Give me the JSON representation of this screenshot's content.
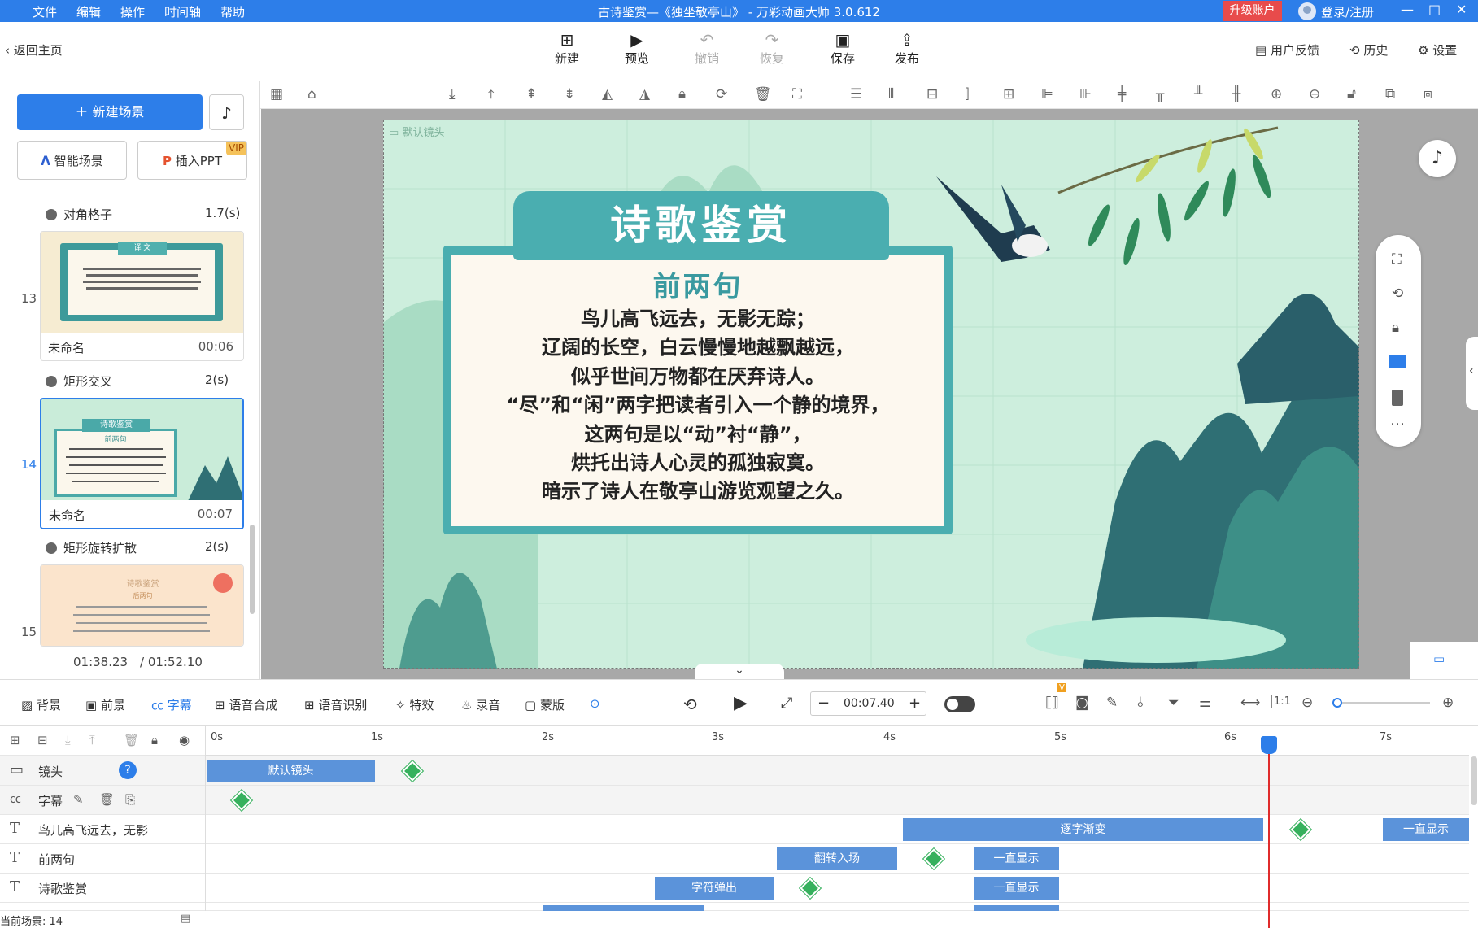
{
  "titlebar": {
    "menu": [
      "文件",
      "编辑",
      "操作",
      "时间轴",
      "帮助"
    ],
    "title": "古诗鉴赏—《独坐敬亭山》 - 万彩动画大师 3.0.612",
    "upgrade": "升级账户",
    "login": "登录/注册",
    "controls": [
      "—",
      "□",
      "✕"
    ]
  },
  "toolbar": {
    "back": "返回主页",
    "buttons": [
      {
        "label": "新建",
        "icon": "plus-square-icon"
      },
      {
        "label": "预览",
        "icon": "play-icon"
      },
      {
        "label": "撤销",
        "icon": "undo-icon",
        "disabled": true
      },
      {
        "label": "恢复",
        "icon": "redo-icon",
        "disabled": true
      },
      {
        "label": "保存",
        "icon": "save-icon"
      },
      {
        "label": "发布",
        "icon": "publish-icon"
      }
    ],
    "right": [
      "用户反馈",
      "历史",
      "设置"
    ]
  },
  "left": {
    "new_scene": "新建场景",
    "smart_scene": "智能场景",
    "insert_ppt": "插入PPT",
    "vip": "VIP",
    "transitions": [
      {
        "name": "对角格子",
        "dur": "1.7(s)"
      },
      {
        "name": "矩形交叉",
        "dur": "2(s)"
      },
      {
        "name": "矩形旋转扩散",
        "dur": "2(s)"
      }
    ],
    "scenes": [
      {
        "num": "13",
        "name": "未命名",
        "time": "00:06"
      },
      {
        "num": "14",
        "name": "未命名",
        "time": "00:07"
      },
      {
        "num": "15",
        "name": "",
        "time": ""
      }
    ],
    "current_time": "01:38.23",
    "total_time": "/ 01:52.10"
  },
  "slide": {
    "camera_label": "默认镜头",
    "title": "诗歌鉴赏",
    "subtitle": "前两句",
    "lines": [
      "鸟儿高飞远去，无影无踪；",
      "辽阔的长空，白云慢慢地越飘越远，",
      "似乎世间万物都在厌弃诗人。",
      "“尽”和“闲”两字把读者引入一个静的境界，",
      "这两句是以“动”衬“静”，",
      "烘托出诗人心灵的孤独寂寞。",
      "暗示了诗人在敬亭山游览观望之久。"
    ],
    "thumb13_title": "译 文",
    "thumb14_title": "诗歌鉴赏",
    "thumb14_sub": "前两句",
    "thumb15_title": "诗歌鉴赏",
    "thumb15_sub": "后两句"
  },
  "timeline": {
    "tabs": [
      "背景",
      "前景",
      "字幕",
      "语音合成",
      "语音识别",
      "特效",
      "录音",
      "蒙版"
    ],
    "time": "00:07.40",
    "ruler": [
      "0s",
      "1s",
      "2s",
      "3s",
      "4s",
      "5s",
      "6s",
      "7s"
    ],
    "tracks": [
      {
        "name": "镜头"
      },
      {
        "name": "字幕"
      },
      {
        "name": "鸟儿高飞远去，无影"
      },
      {
        "name": "前两句"
      },
      {
        "name": "诗歌鉴赏"
      }
    ],
    "clips": {
      "camera": "默认镜头",
      "fade": "逐字渐变",
      "always1": "一直显示",
      "flip": "翻转入场",
      "always2": "一直显示",
      "pop": "字符弹出",
      "always3": "一直显示"
    },
    "current_scene": "当前场景: 14"
  }
}
